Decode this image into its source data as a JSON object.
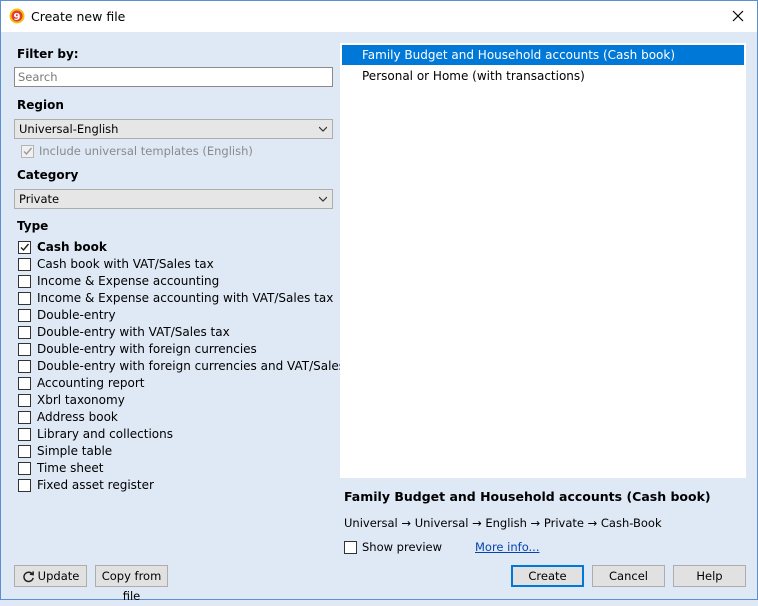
{
  "window": {
    "title": "Create new file",
    "close_label": "✕"
  },
  "filter": {
    "label": "Filter by:",
    "search_placeholder": "Search",
    "search_value": ""
  },
  "region": {
    "label": "Region",
    "selected": "Universal-English",
    "include_universal": {
      "label": "Include universal templates (English)",
      "checked": true,
      "enabled": false
    }
  },
  "category": {
    "label": "Category",
    "selected": "Private"
  },
  "type": {
    "label": "Type",
    "items": [
      {
        "label": "Cash book",
        "checked": true
      },
      {
        "label": "Cash book with VAT/Sales tax",
        "checked": false
      },
      {
        "label": "Income & Expense accounting",
        "checked": false
      },
      {
        "label": "Income & Expense accounting with VAT/Sales tax",
        "checked": false
      },
      {
        "label": "Double-entry",
        "checked": false
      },
      {
        "label": "Double-entry with VAT/Sales tax",
        "checked": false
      },
      {
        "label": "Double-entry with foreign currencies",
        "checked": false
      },
      {
        "label": "Double-entry with foreign currencies and VAT/Sales tax",
        "checked": false
      },
      {
        "label": "Accounting report",
        "checked": false
      },
      {
        "label": "Xbrl taxonomy",
        "checked": false
      },
      {
        "label": "Address book",
        "checked": false
      },
      {
        "label": "Library and collections",
        "checked": false
      },
      {
        "label": "Simple table",
        "checked": false
      },
      {
        "label": "Time sheet",
        "checked": false
      },
      {
        "label": "Fixed asset register",
        "checked": false
      }
    ]
  },
  "templates": {
    "items": [
      {
        "label": "Family Budget and Household accounts (Cash book)",
        "selected": true
      },
      {
        "label": "Personal or Home  (with transactions)",
        "selected": false
      }
    ]
  },
  "details": {
    "title": "Family Budget and Household accounts (Cash book)",
    "path": "Universal → Universal → English → Private → Cash-Book",
    "show_preview_label": "Show preview",
    "show_preview_checked": false,
    "more_info_label": "More info..."
  },
  "buttons": {
    "update": "Update",
    "copy_from_file": "Copy from file",
    "create": "Create",
    "cancel": "Cancel",
    "help": "Help"
  },
  "colors": {
    "selection": "#0078d7",
    "background": "#dfe8f5",
    "link": "#0645ad"
  }
}
